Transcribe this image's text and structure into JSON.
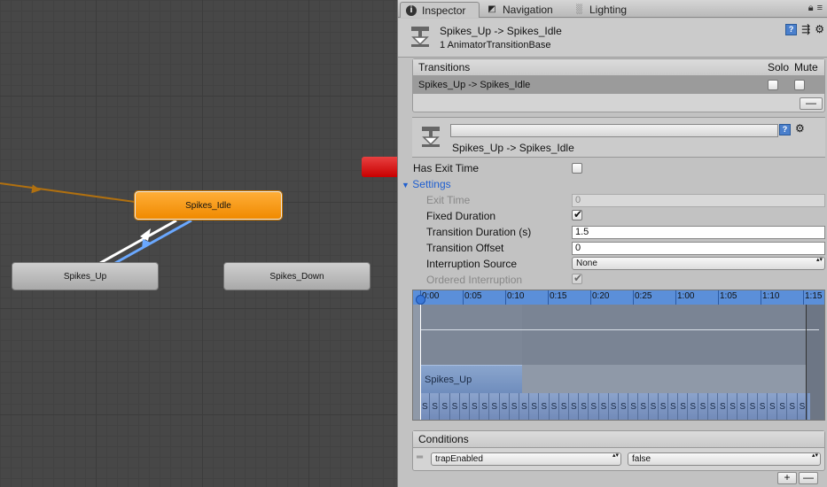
{
  "graph": {
    "nodes": {
      "idle": "Spikes_Idle",
      "up": "Spikes_Up",
      "down": "Spikes_Down"
    }
  },
  "tabs": [
    {
      "label": "Inspector",
      "icon": "info-icon"
    },
    {
      "label": "Navigation",
      "icon": "navigation-icon"
    },
    {
      "label": "Lighting",
      "icon": "lighting-icon"
    }
  ],
  "header": {
    "title": "Spikes_Up -> Spikes_Idle",
    "subtitle": "1 AnimatorTransitionBase"
  },
  "transitions": {
    "title": "Transitions",
    "col_solo": "Solo",
    "col_mute": "Mute",
    "rows": [
      {
        "label": "Spikes_Up -> Spikes_Idle",
        "solo": false,
        "mute": false
      }
    ],
    "remove_label": "—"
  },
  "transition_detail": {
    "name_value": "",
    "label": "Spikes_Up -> Spikes_Idle"
  },
  "properties": {
    "has_exit_time": {
      "label": "Has Exit Time",
      "checked": false
    },
    "settings_label": "Settings",
    "exit_time": {
      "label": "Exit Time",
      "value": "0"
    },
    "fixed_duration": {
      "label": "Fixed Duration",
      "checked": true
    },
    "transition_duration": {
      "label": "Transition Duration (s)",
      "value": "1.5"
    },
    "transition_offset": {
      "label": "Transition Offset",
      "value": "0"
    },
    "interruption_source": {
      "label": "Interruption Source",
      "value": "None"
    },
    "ordered_interruption": {
      "label": "Ordered Interruption",
      "checked": true
    }
  },
  "timeline": {
    "ticks": [
      "0:00",
      "0:05",
      "0:10",
      "0:15",
      "0:20",
      "0:25",
      "1:00",
      "1:05",
      "1:10",
      "1:15"
    ],
    "clip_label": "Spikes_Up",
    "stripe_label": "S",
    "stripe_count": 39
  },
  "conditions": {
    "title": "Conditions",
    "rows": [
      {
        "parameter": "trapEnabled",
        "value": "false"
      }
    ],
    "add_label": "+",
    "remove_label": "—"
  },
  "colors": {
    "state_default": "#b8b8b8",
    "state_default_active": "#f08a00",
    "transition_blue": "#6aa8ff",
    "entry_line": "#c07a10",
    "ruler_blue": "#5b8fd9"
  }
}
